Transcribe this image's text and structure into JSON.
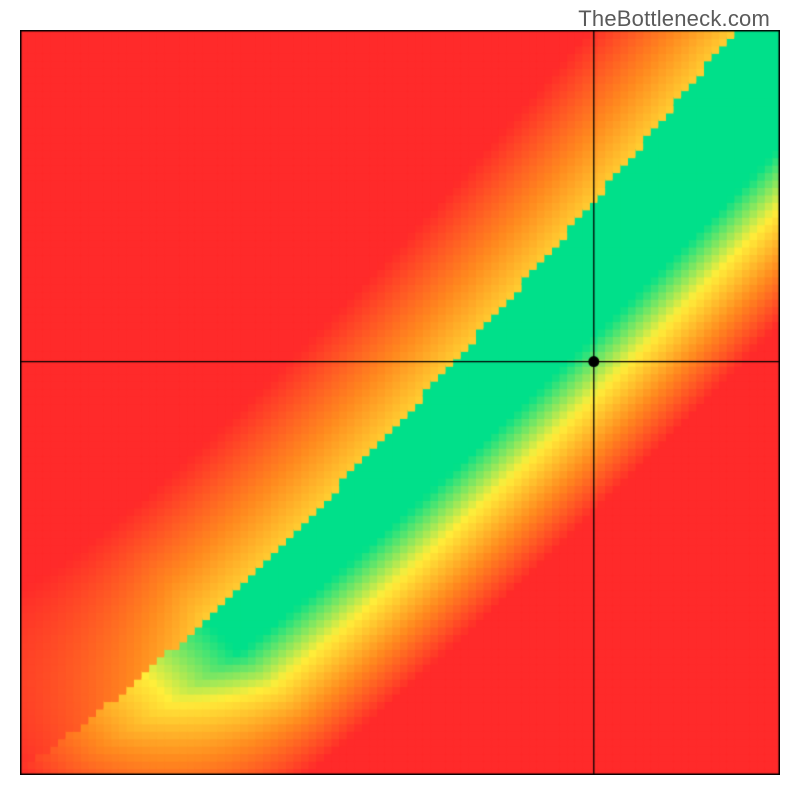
{
  "watermark": "TheBottleneck.com",
  "chart_data": {
    "type": "heatmap",
    "title": "",
    "xlabel": "",
    "ylabel": "",
    "xlim": [
      0,
      100
    ],
    "ylim": [
      0,
      100
    ],
    "crosshair": {
      "x": 75.5,
      "y": 55.5
    },
    "marker": {
      "x": 75.5,
      "y": 55.5
    },
    "optimal_curve_description": "Green band along roughly y = x^1.2 diagonal from bottom-left to top-right, widening toward top-right; surrounded by yellow transition; red in off-diagonal extremes.",
    "color_stops": {
      "red": "#ff2a2a",
      "orange": "#ff8a1f",
      "yellow": "#ffee3a",
      "green": "#00e08a"
    },
    "axis_ticks_visible": false,
    "legend_visible": false,
    "pixelated": true,
    "grid_resolution": 100
  }
}
